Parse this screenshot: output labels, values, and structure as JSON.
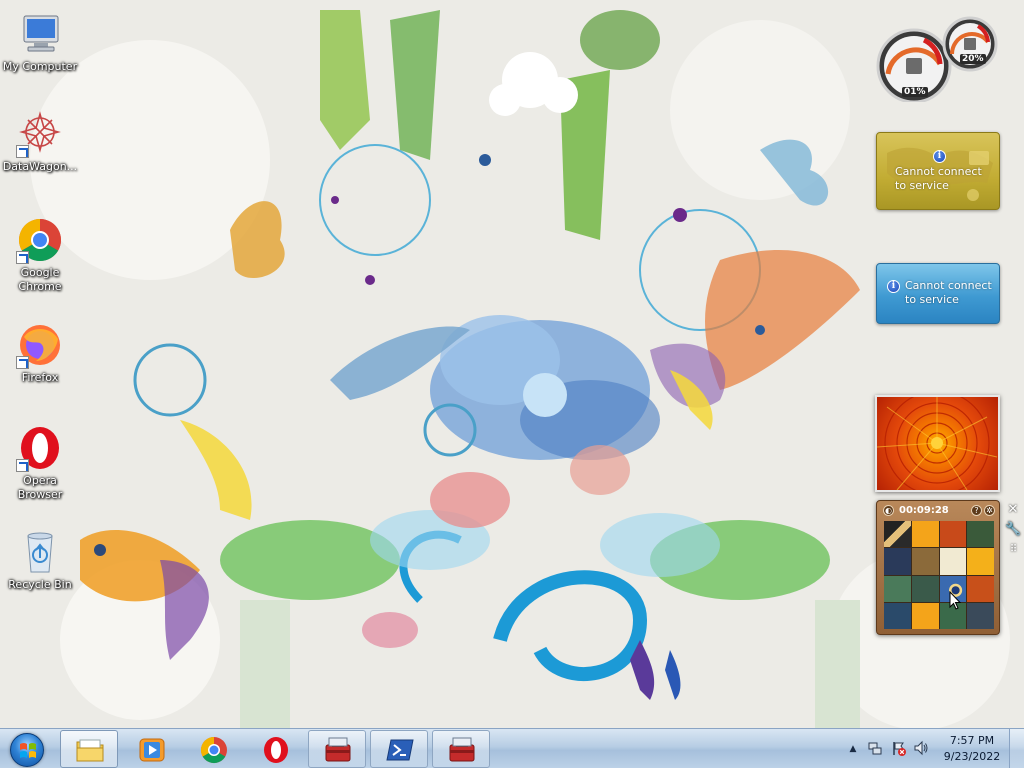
{
  "desktop": {
    "icons": [
      {
        "label": "My Computer",
        "icon": "computer-icon"
      },
      {
        "label": "DataWagon...",
        "icon": "datawagon-icon"
      },
      {
        "label": "Google Chrome",
        "icon": "chrome-icon"
      },
      {
        "label": "Firefox",
        "icon": "firefox-icon"
      },
      {
        "label": "Opera Browser",
        "icon": "opera-icon"
      },
      {
        "label": "Recycle Bin",
        "icon": "recycle-bin-icon"
      }
    ]
  },
  "gadgets": {
    "cpu_meter": {
      "cpu_percent": "01%",
      "memory_percent": "20%"
    },
    "weather": {
      "message": "Cannot connect to service"
    },
    "currency": {
      "message": "Cannot connect to service"
    },
    "slideshow": {
      "image": "orange-chrysanthemum"
    },
    "picture_puzzle": {
      "timer": "00:09:28"
    }
  },
  "taskbar": {
    "start": "start-orb-icon",
    "buttons": [
      {
        "name": "windows-explorer",
        "icon": "folder-icon",
        "state": "active"
      },
      {
        "name": "media-player",
        "icon": "media-player-icon",
        "state": "pinned"
      },
      {
        "name": "google-chrome",
        "icon": "chrome-icon",
        "state": "pinned"
      },
      {
        "name": "opera",
        "icon": "opera-icon",
        "state": "pinned"
      },
      {
        "name": "toolbox-app-1",
        "icon": "toolbox-icon",
        "state": "open"
      },
      {
        "name": "powershell",
        "icon": "powershell-icon",
        "state": "open"
      },
      {
        "name": "toolbox-app-2",
        "icon": "toolbox-icon",
        "state": "open"
      }
    ],
    "tray": {
      "time": "7:57 PM",
      "date": "9/23/2022"
    }
  },
  "colors": {
    "taskbar": "#b7cde4",
    "weather_gadget": "#c2ac33",
    "currency_gadget": "#3f9ad2",
    "puzzle_gadget": "#8f5f35"
  }
}
